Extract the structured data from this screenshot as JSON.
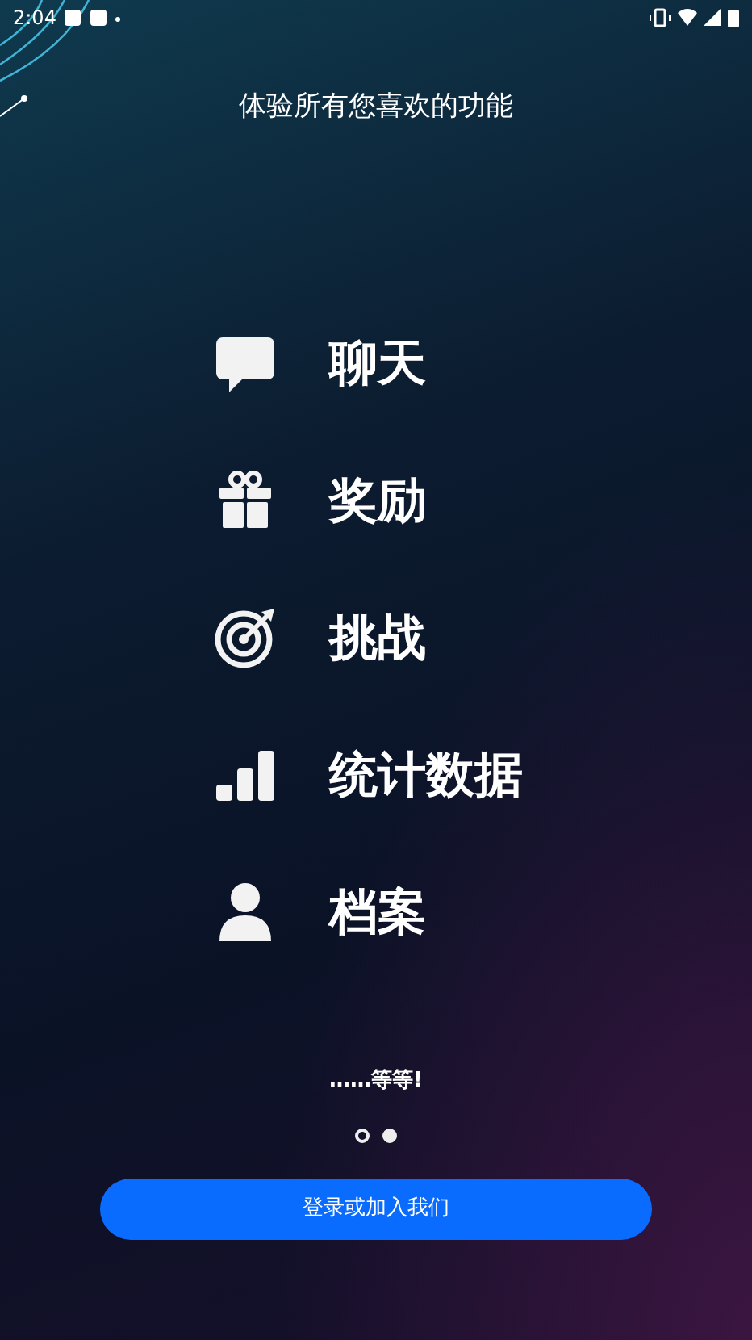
{
  "status_bar": {
    "time": "2:04"
  },
  "title": "体验所有您喜欢的功能",
  "features": [
    {
      "kind": "chat",
      "label": "聊天"
    },
    {
      "kind": "gift",
      "label": "奖励"
    },
    {
      "kind": "target",
      "label": "挑战"
    },
    {
      "kind": "stats",
      "label": "统计数据"
    },
    {
      "kind": "profile",
      "label": "档案"
    }
  ],
  "footer_text": "……等等!",
  "pages": [
    {
      "selected": false
    },
    {
      "selected": true
    }
  ],
  "button": "登录或加入我们"
}
